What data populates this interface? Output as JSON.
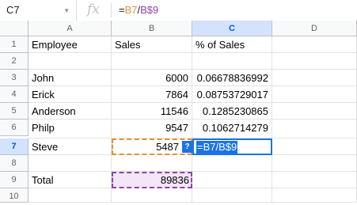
{
  "formula_bar": {
    "name_box": "C7",
    "dropdown_glyph": "▾",
    "fx_label": "fx",
    "formula_tokens": {
      "eq": "=",
      "b7": "B7",
      "op": "/",
      "b9": "B$9"
    }
  },
  "columns": [
    "A",
    "B",
    "C",
    "D"
  ],
  "rows": [
    "1",
    "2",
    "3",
    "4",
    "5",
    "6",
    "7",
    "8",
    "9",
    "10"
  ],
  "cells": {
    "A1": "Employee",
    "B1": "Sales",
    "C1": "% of Sales",
    "A3": "John",
    "B3": "6000",
    "C3": "0.06678836992",
    "A4": "Erick",
    "B4": "7864",
    "C4": "0.08753729017",
    "A5": "Anderson",
    "B5": "11546",
    "C5": "0.1285230865",
    "A6": "Philp",
    "B6": "9547",
    "C6": "0.1062714279",
    "A7": "Steve",
    "B7": "5487",
    "A9": "Total",
    "B9": "89836"
  },
  "editor": {
    "help_glyph": "?",
    "text": "=B7/B$9"
  },
  "colors": {
    "b7_ref": "#e69138",
    "b9_ref": "#8e44ad",
    "active": "#1a73e8"
  }
}
